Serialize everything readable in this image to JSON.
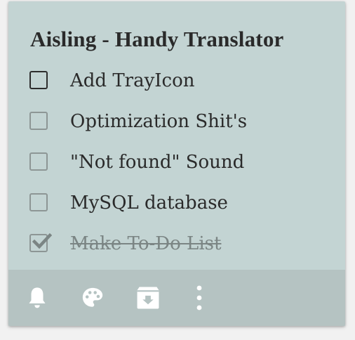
{
  "note": {
    "title": "Aisling - Handy Translator",
    "background_color": "#c3d4d3",
    "toolbar_color": "#b5c3c2"
  },
  "checklist": [
    {
      "label": "Add TrayIcon",
      "checked": false,
      "focused": true
    },
    {
      "label": "Optimization Shit's",
      "checked": false,
      "focused": false
    },
    {
      "label": "\"Not found\" Sound",
      "checked": false,
      "focused": false
    },
    {
      "label": "MySQL database",
      "checked": false,
      "focused": false
    },
    {
      "label": "Make To-Do List",
      "checked": true,
      "focused": false
    }
  ],
  "toolbar": {
    "icons": [
      "bell-icon",
      "palette-icon",
      "archive-icon",
      "more-vert-icon"
    ]
  }
}
